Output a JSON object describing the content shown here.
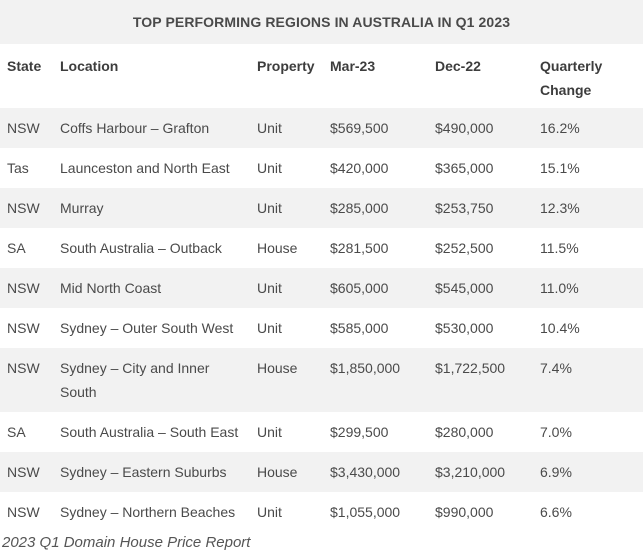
{
  "table": {
    "title": "TOP PERFORMING REGIONS IN AUSTRALIA IN Q1 2023",
    "headers": {
      "state": "State",
      "location": "Location",
      "property": "Property",
      "mar23": "Mar-23",
      "dec22": "Dec-22",
      "change": "Quarterly Change"
    },
    "rows": [
      {
        "state": "NSW",
        "location": "Coffs Harbour – Grafton",
        "property": "Unit",
        "mar23": "$569,500",
        "dec22": "$490,000",
        "change": "16.2%"
      },
      {
        "state": "Tas",
        "location": "Launceston and North East",
        "property": "Unit",
        "mar23": "$420,000",
        "dec22": "$365,000",
        "change": "15.1%"
      },
      {
        "state": "NSW",
        "location": "Murray",
        "property": "Unit",
        "mar23": "$285,000",
        "dec22": "$253,750",
        "change": "12.3%"
      },
      {
        "state": "SA",
        "location": "South Australia – Outback",
        "property": "House",
        "mar23": "$281,500",
        "dec22": "$252,500",
        "change": "11.5%"
      },
      {
        "state": "NSW",
        "location": "Mid North Coast",
        "property": "Unit",
        "mar23": "$605,000",
        "dec22": "$545,000",
        "change": "11.0%"
      },
      {
        "state": "NSW",
        "location": "Sydney – Outer South West",
        "property": "Unit",
        "mar23": "$585,000",
        "dec22": "$530,000",
        "change": "10.4%"
      },
      {
        "state": "NSW",
        "location": "Sydney – City and Inner South",
        "property": "House",
        "mar23": "$1,850,000",
        "dec22": "$1,722,500",
        "change": "7.4%"
      },
      {
        "state": "SA",
        "location": "South Australia – South East",
        "property": "Unit",
        "mar23": "$299,500",
        "dec22": "$280,000",
        "change": "7.0%"
      },
      {
        "state": "NSW",
        "location": "Sydney – Eastern Suburbs",
        "property": "House",
        "mar23": "$3,430,000",
        "dec22": "$3,210,000",
        "change": "6.9%"
      },
      {
        "state": "NSW",
        "location": "Sydney – Northern Beaches",
        "property": "Unit",
        "mar23": "$1,055,000",
        "dec22": "$990,000",
        "change": "6.6%"
      }
    ]
  },
  "caption": "2023 Q1 Domain House Price Report"
}
